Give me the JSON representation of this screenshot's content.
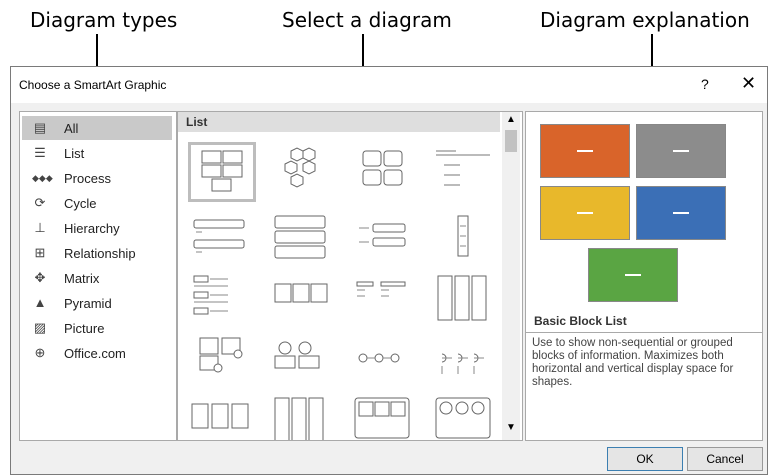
{
  "callouts": {
    "types": "Diagram types",
    "select": "Select a diagram",
    "explanation": "Diagram explanation"
  },
  "dialog": {
    "title": "Choose a SmartArt Graphic",
    "help": "?",
    "close": "✕"
  },
  "categories": [
    {
      "label": "All",
      "icon": "all-icon",
      "selected": true
    },
    {
      "label": "List",
      "icon": "list-icon"
    },
    {
      "label": "Process",
      "icon": "process-icon"
    },
    {
      "label": "Cycle",
      "icon": "cycle-icon"
    },
    {
      "label": "Hierarchy",
      "icon": "hierarchy-icon"
    },
    {
      "label": "Relationship",
      "icon": "relationship-icon"
    },
    {
      "label": "Matrix",
      "icon": "matrix-icon"
    },
    {
      "label": "Pyramid",
      "icon": "pyramid-icon"
    },
    {
      "label": "Picture",
      "icon": "picture-icon"
    },
    {
      "label": "Office.com",
      "icon": "globe-icon"
    }
  ],
  "gallery": {
    "section": "List",
    "selected_index": 0
  },
  "preview": {
    "name": "Basic Block List",
    "description": "Use to show non-sequential or grouped blocks of information. Maximizes both horizontal and vertical display space for shapes.",
    "block_colors": [
      "#d9642a",
      "#8c8c8c",
      "#e8b82b",
      "#3b6fb6",
      "#5aa543"
    ]
  },
  "buttons": {
    "ok": "OK",
    "cancel": "Cancel"
  }
}
